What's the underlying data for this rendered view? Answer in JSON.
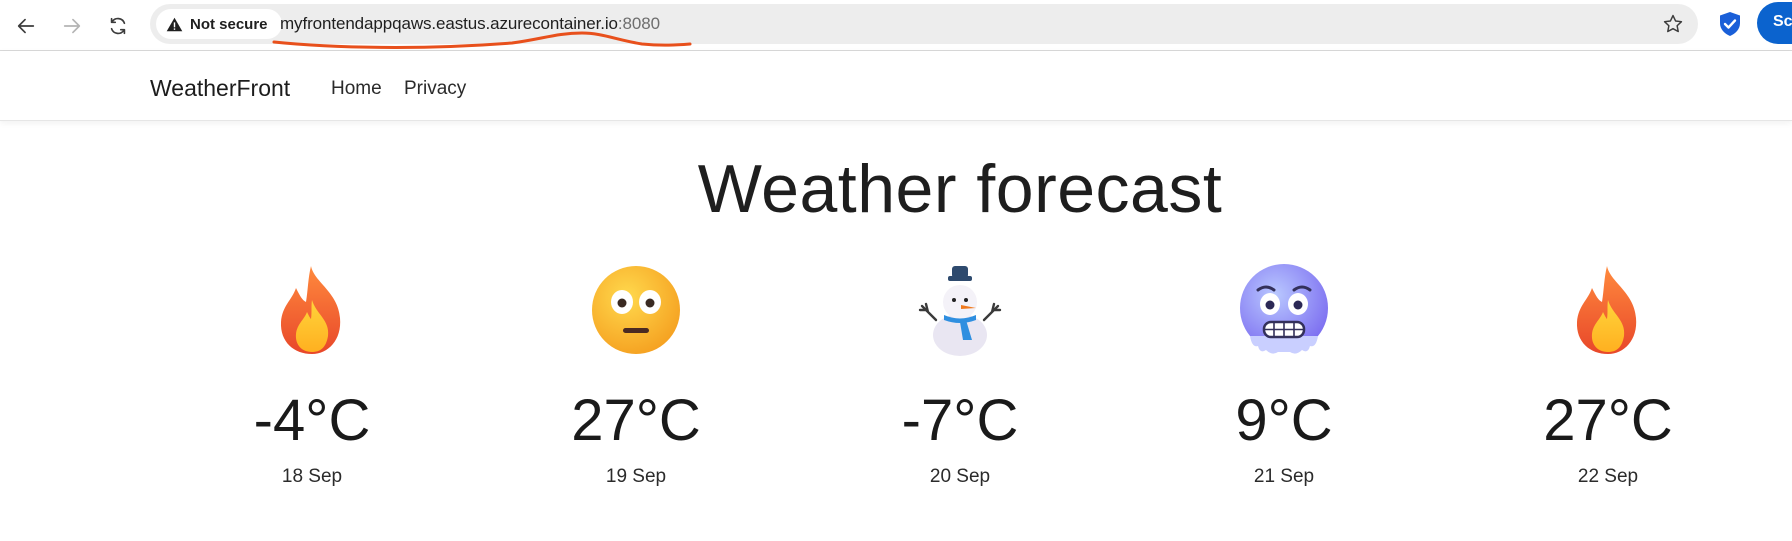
{
  "browser": {
    "security_label": "Not secure",
    "url_host": "myfrontendappqaws.eastus.azurecontainer.io",
    "url_port": ":8080",
    "profile_label": "Sc",
    "annotation_color": "#e8501c"
  },
  "app": {
    "brand": "WeatherFront",
    "nav": {
      "home": "Home",
      "privacy": "Privacy"
    },
    "heading": "Weather forecast"
  },
  "forecast": [
    {
      "icon": "fire-icon",
      "temperature": "-4°C",
      "date": "18 Sep"
    },
    {
      "icon": "flushed-face-icon",
      "temperature": "27°C",
      "date": "19 Sep"
    },
    {
      "icon": "snowman-icon",
      "temperature": "-7°C",
      "date": "20 Sep"
    },
    {
      "icon": "cold-face-icon",
      "temperature": "9°C",
      "date": "21 Sep"
    },
    {
      "icon": "fire-icon",
      "temperature": "27°C",
      "date": "22 Sep"
    }
  ]
}
